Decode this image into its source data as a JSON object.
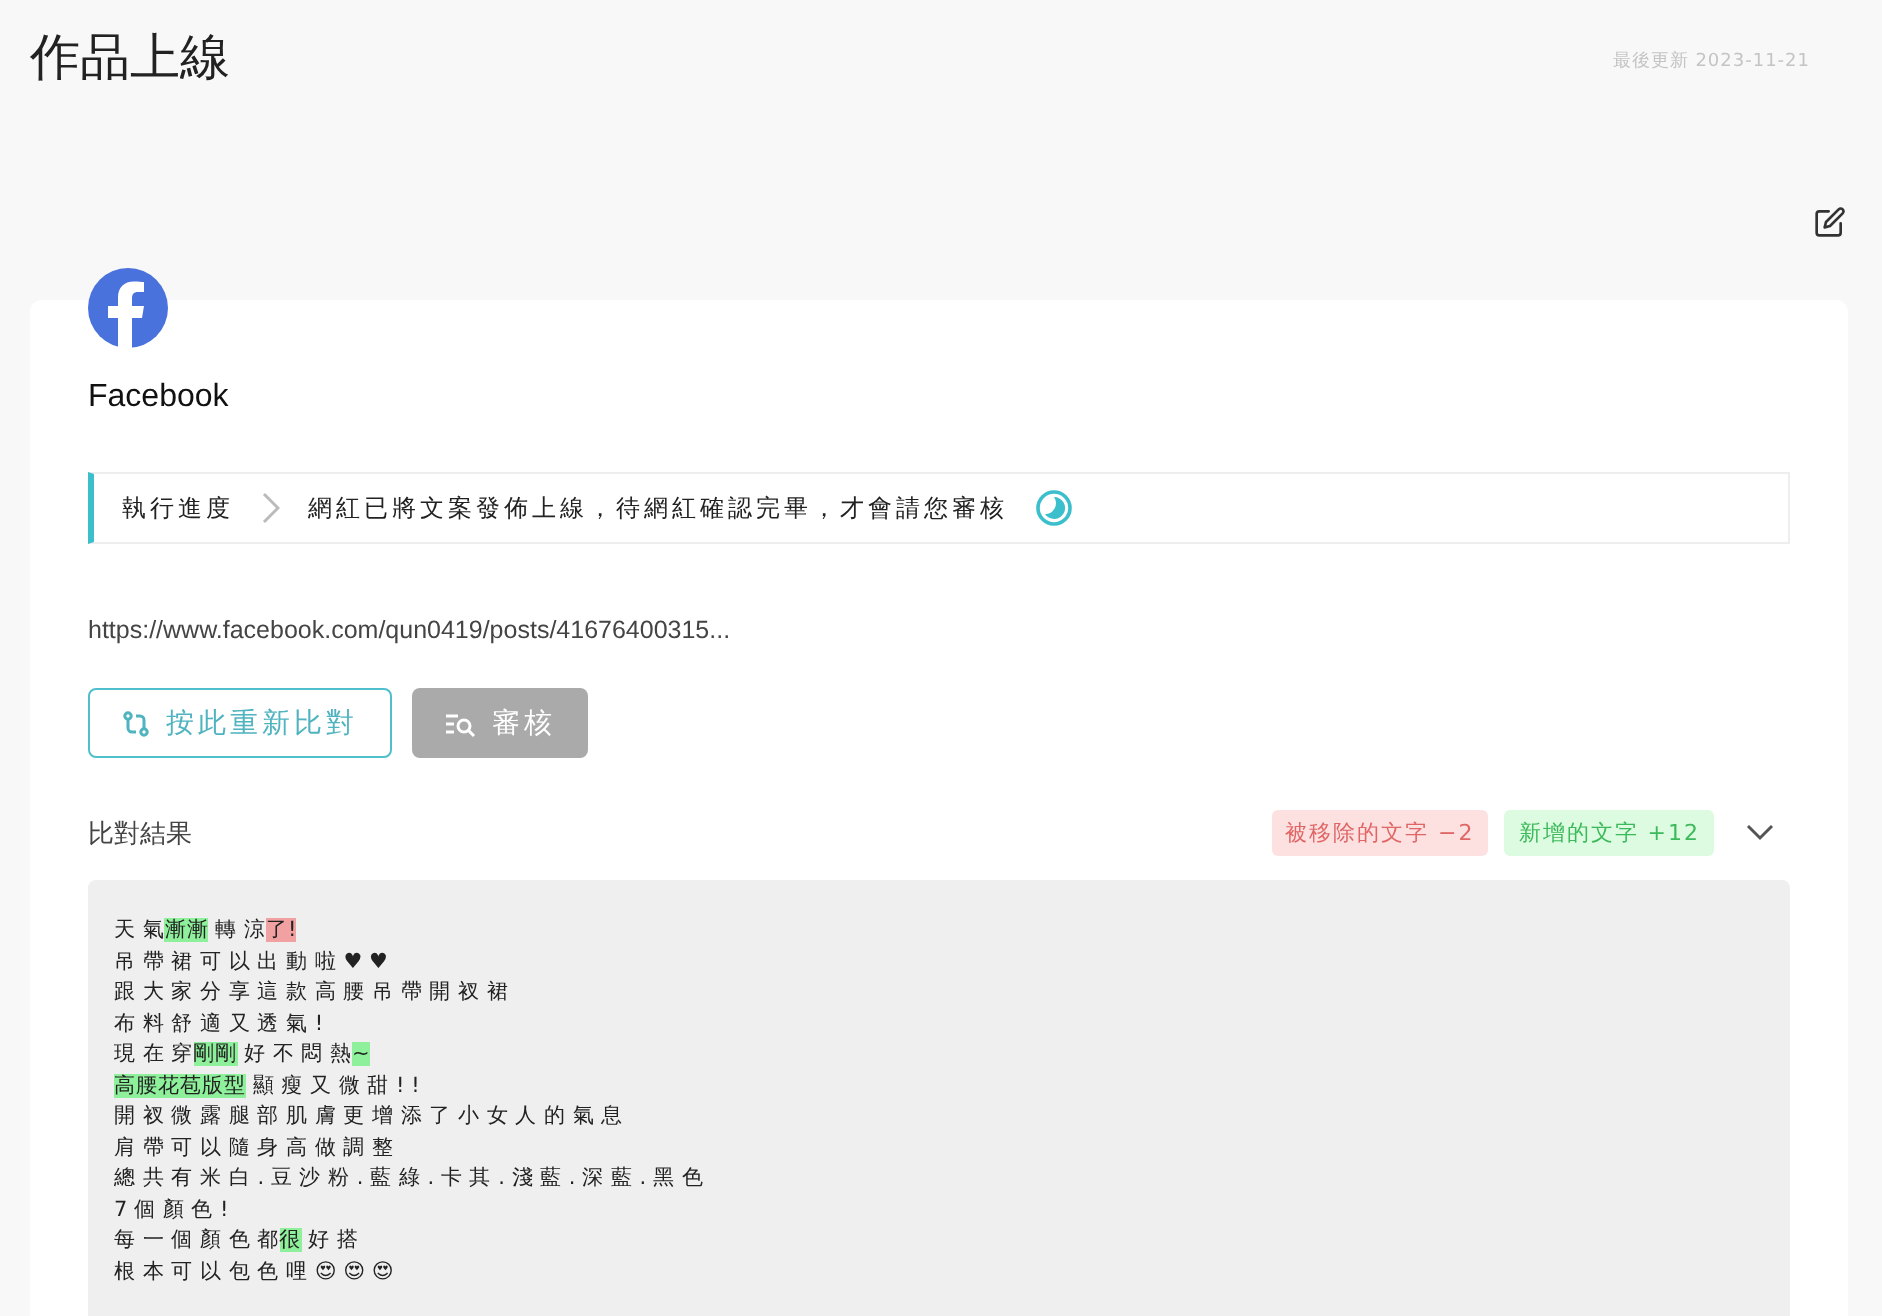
{
  "page": {
    "title": "作品上線",
    "updated": "最後更新 2023-11-21"
  },
  "platform": {
    "name": "Facebook"
  },
  "progress": {
    "label": "執行進度",
    "message": "網紅已將文案發佈上線，待網紅確認完畢，才會請您審核"
  },
  "post_url": "https://www.facebook.com/qun0419/posts/41676400315...",
  "buttons": [
    {
      "label": "按此重新比對",
      "kind": "outline"
    },
    {
      "label": "審核",
      "kind": "review"
    }
  ],
  "comparison": {
    "title": "比對結果",
    "removed_badge": "被移除的文字 −2",
    "added_badge": "新增的文字 +12",
    "expanded": true,
    "lines": [
      [
        {
          "text": "天 氣",
          "kind": "same"
        },
        {
          "text": "漸漸",
          "kind": "added"
        },
        {
          "text": " 轉 涼",
          "kind": "same"
        },
        {
          "text": "了!",
          "kind": "removed"
        }
      ],
      [
        {
          "text": "吊 帶 裙 可 以 出 動 啦 ♥ ♥",
          "kind": "same"
        }
      ],
      [
        {
          "text": "跟 大 家 分 享 這 款 高 腰 吊 帶 開 衩 裙",
          "kind": "same"
        }
      ],
      [
        {
          "text": "布 料 舒 適 又 透 氣 !",
          "kind": "same"
        }
      ],
      [
        {
          "text": "現 在 穿",
          "kind": "same"
        },
        {
          "text": "剛剛",
          "kind": "added"
        },
        {
          "text": " 好 不 悶 熱",
          "kind": "same"
        },
        {
          "text": "~",
          "kind": "added"
        }
      ],
      [
        {
          "text": "高腰花苞版型",
          "kind": "added"
        },
        {
          "text": " 顯 瘦 又 微 甜 ! !",
          "kind": "same"
        }
      ],
      [
        {
          "text": "開 衩 微 露 腿 部 肌 膚 更 增 添 了 小 女 人 的 氣 息",
          "kind": "same"
        }
      ],
      [
        {
          "text": "肩 帶 可 以 隨 身 高 做 調 整",
          "kind": "same"
        }
      ],
      [
        {
          "text": "總 共 有 米 白 . 豆 沙 粉 . 藍 綠 . 卡 其 . 淺 藍 . 深 藍 . 黑 色",
          "kind": "same"
        }
      ],
      [
        {
          "text": "7 個 顏 色 !",
          "kind": "same"
        }
      ],
      [
        {
          "text": "每 一 個 顏 色 都",
          "kind": "same"
        },
        {
          "text": "很",
          "kind": "added"
        },
        {
          "text": " 好 搭",
          "kind": "same"
        }
      ],
      [
        {
          "text": "根 本 可 以 包 色 哩 😍 😍 😍",
          "kind": "same"
        }
      ]
    ]
  }
}
